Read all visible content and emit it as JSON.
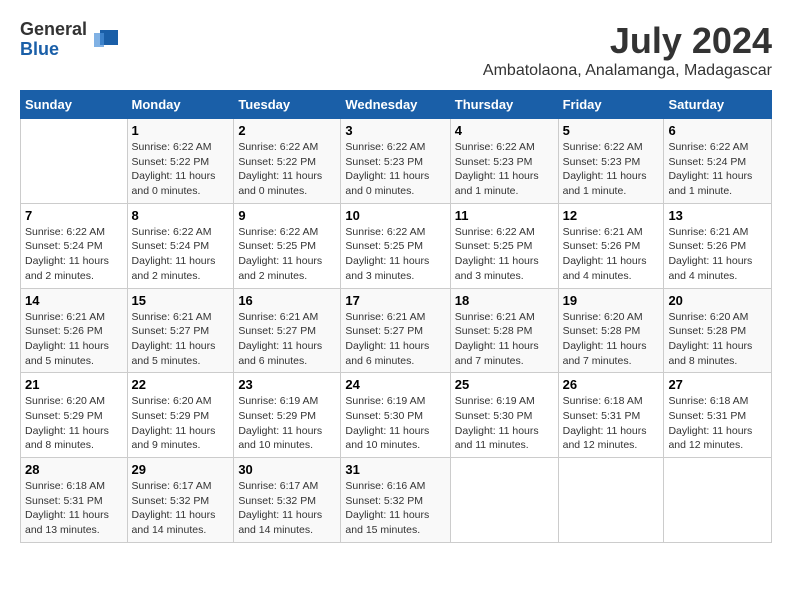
{
  "logo": {
    "general": "General",
    "blue": "Blue"
  },
  "title": "July 2024",
  "subtitle": "Ambatolaona, Analamanga, Madagascar",
  "days_of_week": [
    "Sunday",
    "Monday",
    "Tuesday",
    "Wednesday",
    "Thursday",
    "Friday",
    "Saturday"
  ],
  "weeks": [
    [
      {
        "day": "",
        "info": ""
      },
      {
        "day": "1",
        "info": "Sunrise: 6:22 AM\nSunset: 5:22 PM\nDaylight: 11 hours\nand 0 minutes."
      },
      {
        "day": "2",
        "info": "Sunrise: 6:22 AM\nSunset: 5:22 PM\nDaylight: 11 hours\nand 0 minutes."
      },
      {
        "day": "3",
        "info": "Sunrise: 6:22 AM\nSunset: 5:23 PM\nDaylight: 11 hours\nand 0 minutes."
      },
      {
        "day": "4",
        "info": "Sunrise: 6:22 AM\nSunset: 5:23 PM\nDaylight: 11 hours\nand 1 minute."
      },
      {
        "day": "5",
        "info": "Sunrise: 6:22 AM\nSunset: 5:23 PM\nDaylight: 11 hours\nand 1 minute."
      },
      {
        "day": "6",
        "info": "Sunrise: 6:22 AM\nSunset: 5:24 PM\nDaylight: 11 hours\nand 1 minute."
      }
    ],
    [
      {
        "day": "7",
        "info": "Sunrise: 6:22 AM\nSunset: 5:24 PM\nDaylight: 11 hours\nand 2 minutes."
      },
      {
        "day": "8",
        "info": "Sunrise: 6:22 AM\nSunset: 5:24 PM\nDaylight: 11 hours\nand 2 minutes."
      },
      {
        "day": "9",
        "info": "Sunrise: 6:22 AM\nSunset: 5:25 PM\nDaylight: 11 hours\nand 2 minutes."
      },
      {
        "day": "10",
        "info": "Sunrise: 6:22 AM\nSunset: 5:25 PM\nDaylight: 11 hours\nand 3 minutes."
      },
      {
        "day": "11",
        "info": "Sunrise: 6:22 AM\nSunset: 5:25 PM\nDaylight: 11 hours\nand 3 minutes."
      },
      {
        "day": "12",
        "info": "Sunrise: 6:21 AM\nSunset: 5:26 PM\nDaylight: 11 hours\nand 4 minutes."
      },
      {
        "day": "13",
        "info": "Sunrise: 6:21 AM\nSunset: 5:26 PM\nDaylight: 11 hours\nand 4 minutes."
      }
    ],
    [
      {
        "day": "14",
        "info": "Sunrise: 6:21 AM\nSunset: 5:26 PM\nDaylight: 11 hours\nand 5 minutes."
      },
      {
        "day": "15",
        "info": "Sunrise: 6:21 AM\nSunset: 5:27 PM\nDaylight: 11 hours\nand 5 minutes."
      },
      {
        "day": "16",
        "info": "Sunrise: 6:21 AM\nSunset: 5:27 PM\nDaylight: 11 hours\nand 6 minutes."
      },
      {
        "day": "17",
        "info": "Sunrise: 6:21 AM\nSunset: 5:27 PM\nDaylight: 11 hours\nand 6 minutes."
      },
      {
        "day": "18",
        "info": "Sunrise: 6:21 AM\nSunset: 5:28 PM\nDaylight: 11 hours\nand 7 minutes."
      },
      {
        "day": "19",
        "info": "Sunrise: 6:20 AM\nSunset: 5:28 PM\nDaylight: 11 hours\nand 7 minutes."
      },
      {
        "day": "20",
        "info": "Sunrise: 6:20 AM\nSunset: 5:28 PM\nDaylight: 11 hours\nand 8 minutes."
      }
    ],
    [
      {
        "day": "21",
        "info": "Sunrise: 6:20 AM\nSunset: 5:29 PM\nDaylight: 11 hours\nand 8 minutes."
      },
      {
        "day": "22",
        "info": "Sunrise: 6:20 AM\nSunset: 5:29 PM\nDaylight: 11 hours\nand 9 minutes."
      },
      {
        "day": "23",
        "info": "Sunrise: 6:19 AM\nSunset: 5:29 PM\nDaylight: 11 hours\nand 10 minutes."
      },
      {
        "day": "24",
        "info": "Sunrise: 6:19 AM\nSunset: 5:30 PM\nDaylight: 11 hours\nand 10 minutes."
      },
      {
        "day": "25",
        "info": "Sunrise: 6:19 AM\nSunset: 5:30 PM\nDaylight: 11 hours\nand 11 minutes."
      },
      {
        "day": "26",
        "info": "Sunrise: 6:18 AM\nSunset: 5:31 PM\nDaylight: 11 hours\nand 12 minutes."
      },
      {
        "day": "27",
        "info": "Sunrise: 6:18 AM\nSunset: 5:31 PM\nDaylight: 11 hours\nand 12 minutes."
      }
    ],
    [
      {
        "day": "28",
        "info": "Sunrise: 6:18 AM\nSunset: 5:31 PM\nDaylight: 11 hours\nand 13 minutes."
      },
      {
        "day": "29",
        "info": "Sunrise: 6:17 AM\nSunset: 5:32 PM\nDaylight: 11 hours\nand 14 minutes."
      },
      {
        "day": "30",
        "info": "Sunrise: 6:17 AM\nSunset: 5:32 PM\nDaylight: 11 hours\nand 14 minutes."
      },
      {
        "day": "31",
        "info": "Sunrise: 6:16 AM\nSunset: 5:32 PM\nDaylight: 11 hours\nand 15 minutes."
      },
      {
        "day": "",
        "info": ""
      },
      {
        "day": "",
        "info": ""
      },
      {
        "day": "",
        "info": ""
      }
    ]
  ]
}
